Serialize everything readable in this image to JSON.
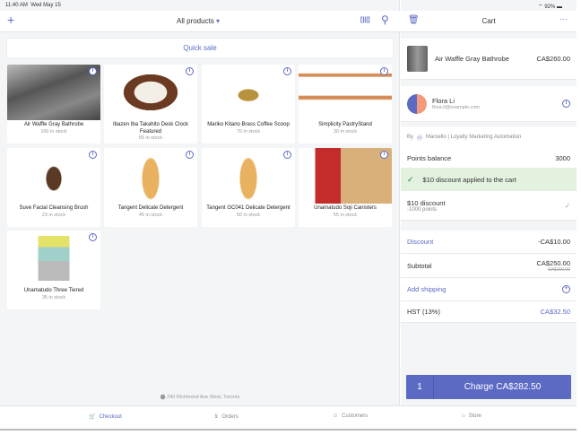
{
  "status": {
    "time": "11:40 AM",
    "date": "Wed May 15",
    "battery": "92%"
  },
  "header": {
    "title": "All products",
    "quick_sale": "Quick sale"
  },
  "products": [
    {
      "name": "Air Waffle Gray Bathrobe",
      "stock": "100 in stock"
    },
    {
      "name": "Ibazen Iba Takahito Desk Clock Featured",
      "stock": "65 in stock"
    },
    {
      "name": "Mariko Kitano Brass Coffee Scoop",
      "stock": "70 in stock"
    },
    {
      "name": "Simplicity PastryStand",
      "stock": "30 in stock"
    },
    {
      "name": "Suve Facial Cleansing Brush",
      "stock": "23 in stock"
    },
    {
      "name": "Tangent Delicate Detergent",
      "stock": "45 in stock"
    },
    {
      "name": "Tangent GC041 Delicate Detergent",
      "stock": "50 in stock"
    },
    {
      "name": "Unamatudo Soji Canisters",
      "stock": "55 in stock"
    },
    {
      "name": "Unamatudo Three Tiered",
      "stock": "35 in stock"
    }
  ],
  "location": "240 Richmond Ave West, Toronto",
  "cart": {
    "title": "Cart",
    "item": {
      "name": "Air Waffle Gray Bathrobe",
      "price": "CA$260.00"
    },
    "customer": {
      "name": "Flora Li",
      "email": "flora.li@example.com"
    },
    "app_by": "By",
    "app_name": "Marsello | Loyalty Marketing Automation",
    "points_label": "Points balance",
    "points_value": "3000",
    "banner": "$10 discount applied to the cart",
    "reward_title": "$10 discount",
    "reward_sub": "-1000 points",
    "discount_label": "Discount",
    "discount_value": "-CA$10.00",
    "subtotal_label": "Subtotal",
    "subtotal_value": "CA$250.00",
    "subtotal_old": "CA$260.00",
    "shipping_label": "Add shipping",
    "tax_label": "HST (13%)",
    "tax_value": "CA$32.50",
    "qty": "1",
    "charge": "Charge CA$282.50"
  },
  "tabs": [
    "Checkout",
    "Orders",
    "Customers",
    "Store"
  ],
  "colors": {
    "accent": "#5c6ac4",
    "success_bg": "#e3f1df"
  }
}
